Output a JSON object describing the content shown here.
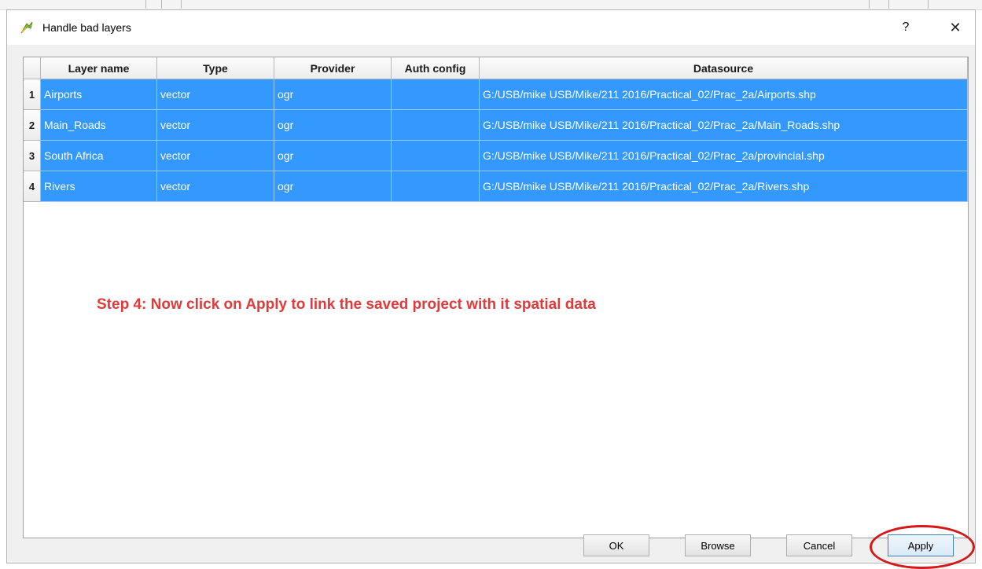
{
  "dialog": {
    "title": "Handle bad layers",
    "help_label": "?",
    "close_label": "✕"
  },
  "table": {
    "columns": [
      "Layer name",
      "Type",
      "Provider",
      "Auth config",
      "Datasource"
    ],
    "rows": [
      {
        "num": "1",
        "layer": "Airports",
        "type": "vector",
        "provider": "ogr",
        "auth": "",
        "datasource": "G:/USB/mike USB/Mike/211 2016/Practical_02/Prac_2a/Airports.shp"
      },
      {
        "num": "2",
        "layer": "Main_Roads",
        "type": "vector",
        "provider": "ogr",
        "auth": "",
        "datasource": "G:/USB/mike USB/Mike/211 2016/Practical_02/Prac_2a/Main_Roads.shp"
      },
      {
        "num": "3",
        "layer": "South Africa",
        "type": "vector",
        "provider": "ogr",
        "auth": "",
        "datasource": "G:/USB/mike USB/Mike/211 2016/Practical_02/Prac_2a/provincial.shp"
      },
      {
        "num": "4",
        "layer": "Rivers",
        "type": "vector",
        "provider": "ogr",
        "auth": "",
        "datasource": "G:/USB/mike USB/Mike/211 2016/Practical_02/Prac_2a/Rivers.shp"
      }
    ],
    "selection_color": "#3399ff"
  },
  "annotation": {
    "text": "Step 4: Now click on Apply to link the saved project with it spatial data",
    "color": "#e03a3a"
  },
  "buttons": {
    "ok": "OK",
    "browse": "Browse",
    "cancel": "Cancel",
    "apply": "Apply"
  },
  "icons": {
    "app": "qgis-icon",
    "close": "close-icon"
  }
}
